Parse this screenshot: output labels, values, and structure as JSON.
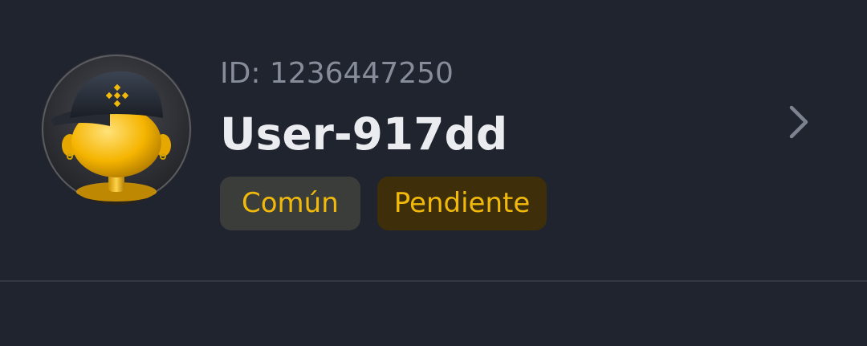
{
  "profile": {
    "id_text": "ID: 1236447250",
    "username": "User-917dd",
    "badges": [
      "Común",
      "Pendiente"
    ],
    "avatar_icon": "avatar-cap-character-icon",
    "chevron_icon": "chevron-right-icon"
  },
  "colors": {
    "background": "#20242e",
    "badge_text": "#f0b90b",
    "badge_common_bg": "#3b3d3a",
    "badge_pending_bg": "#3e2f0a",
    "id_text": "#868c99",
    "username_text": "#eaecef"
  }
}
